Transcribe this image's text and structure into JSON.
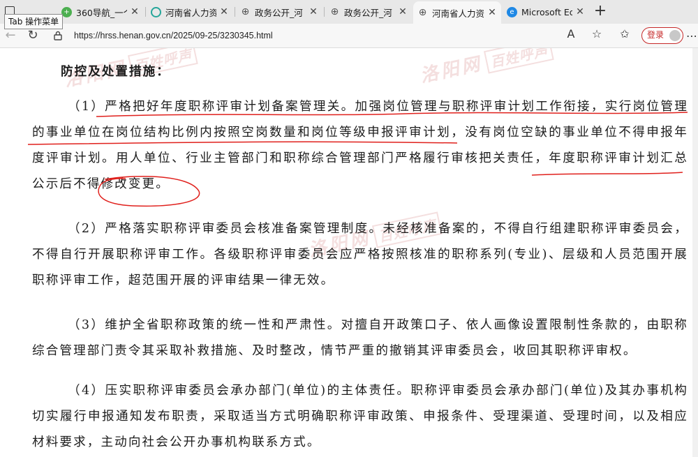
{
  "browser": {
    "tooltip": "Tab 操作菜单",
    "tabs": [
      {
        "title": "360导航_一个",
        "icon": "360-icon",
        "color": "#4caf50"
      },
      {
        "title": "河南省人力资",
        "icon": "search-circle-icon",
        "color": "#26a69a"
      },
      {
        "title": "政务公开_河",
        "icon": "globe-icon",
        "color": "#555555"
      },
      {
        "title": "政务公开_河",
        "icon": "globe-icon",
        "color": "#555555"
      },
      {
        "title": "河南省人力资",
        "icon": "globe-icon",
        "color": "#555555"
      },
      {
        "title": "Microsoft Ed",
        "icon": "edge-icon",
        "color": "#1e88e5"
      }
    ],
    "url": "https://hrss.henan.gov.cn/2025/09-25/3230345.html",
    "login_label": "登录"
  },
  "document": {
    "heading": "防控及处置措施：",
    "paragraphs": [
      "（1）严格把好年度职称评审计划备案管理关。加强岗位管理与职称评审计划工作衔接，实行岗位管理的事业单位在岗位结构比例内按照空岗数量和岗位等级申报评审计划，没有岗位空缺的事业单位不得申报年度评审计划。用人单位、行业主管部门和职称综合管理部门严格履行审核把关责任，年度职称评审计划汇总公示后不得修改变更。",
      "（2）严格落实职称评审委员会核准备案管理制度。未经核准备案的，不得自行组建职称评审委员会，不得自行开展职称评审工作。各级职称评审委员会应严格按照核准的职称系列(专业)、层级和人员范围开展职称评审工作，超范围开展的评审结果一律无效。",
      "（3）维护全省职称政策的统一性和严肃性。对擅自开政策口子、依人画像设置限制性条款的，由职称综合管理部门责令其采取补救措施、及时整改，情节严重的撤销其评审委员会，收回其职称评审权。",
      "（4）压实职称评审委员会承办部门(单位)的主体责任。职称评审委员会承办部门(单位)及其办事机构切实履行申报通知发布职责，采取适当方式明确职称评审政策、申报条件、受理渠道、受理时间，以及相应材料要求，主动向社会公开办事机构联系方式。"
    ],
    "watermarks": [
      {
        "text": "洛阳网",
        "box": "百姓呼声"
      },
      {
        "text": "洛阳网",
        "box": "百姓呼声"
      },
      {
        "text": "洛阳网",
        "box": "百姓呼声"
      }
    ]
  },
  "colors": {
    "annotation": "#e0201c",
    "tabstrip": "#e8e8e8",
    "login": "#c62828"
  }
}
